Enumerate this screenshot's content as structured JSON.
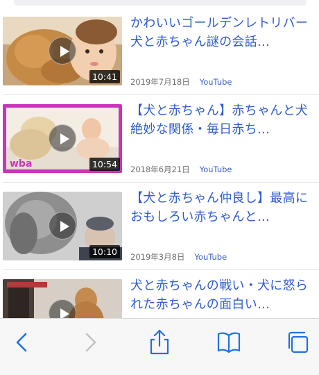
{
  "results": [
    {
      "title": "かわいいゴールデンレトリバー犬と赤ちゃん謎の会話...",
      "date": "2019年7月18日",
      "source": "YouTube",
      "duration": "10:41"
    },
    {
      "title": "【犬と赤ちゃん】赤ちゃんと犬絶妙な関係・毎日赤ち...",
      "date": "2018年6月21日",
      "source": "YouTube",
      "duration": "10:54"
    },
    {
      "title": "【犬と赤ちゃん仲良し】最高におもしろい赤ちゃんと...",
      "date": "2019年3月8日",
      "source": "YouTube",
      "duration": "10:10"
    },
    {
      "title": "犬と赤ちゃんの戦い・犬に怒られた赤ちゃんの面白い...",
      "date": "",
      "source": "",
      "duration": ""
    }
  ],
  "toolbar": {
    "icons": [
      "back-icon",
      "forward-icon",
      "share-icon",
      "bookmarks-icon",
      "tabs-icon"
    ]
  },
  "colors": {
    "link": "#2f5bd0",
    "meta": "#6d6d72",
    "toolbar_icon": "#1f6fe5",
    "toolbar_icon_disabled": "#c4c4c8"
  }
}
